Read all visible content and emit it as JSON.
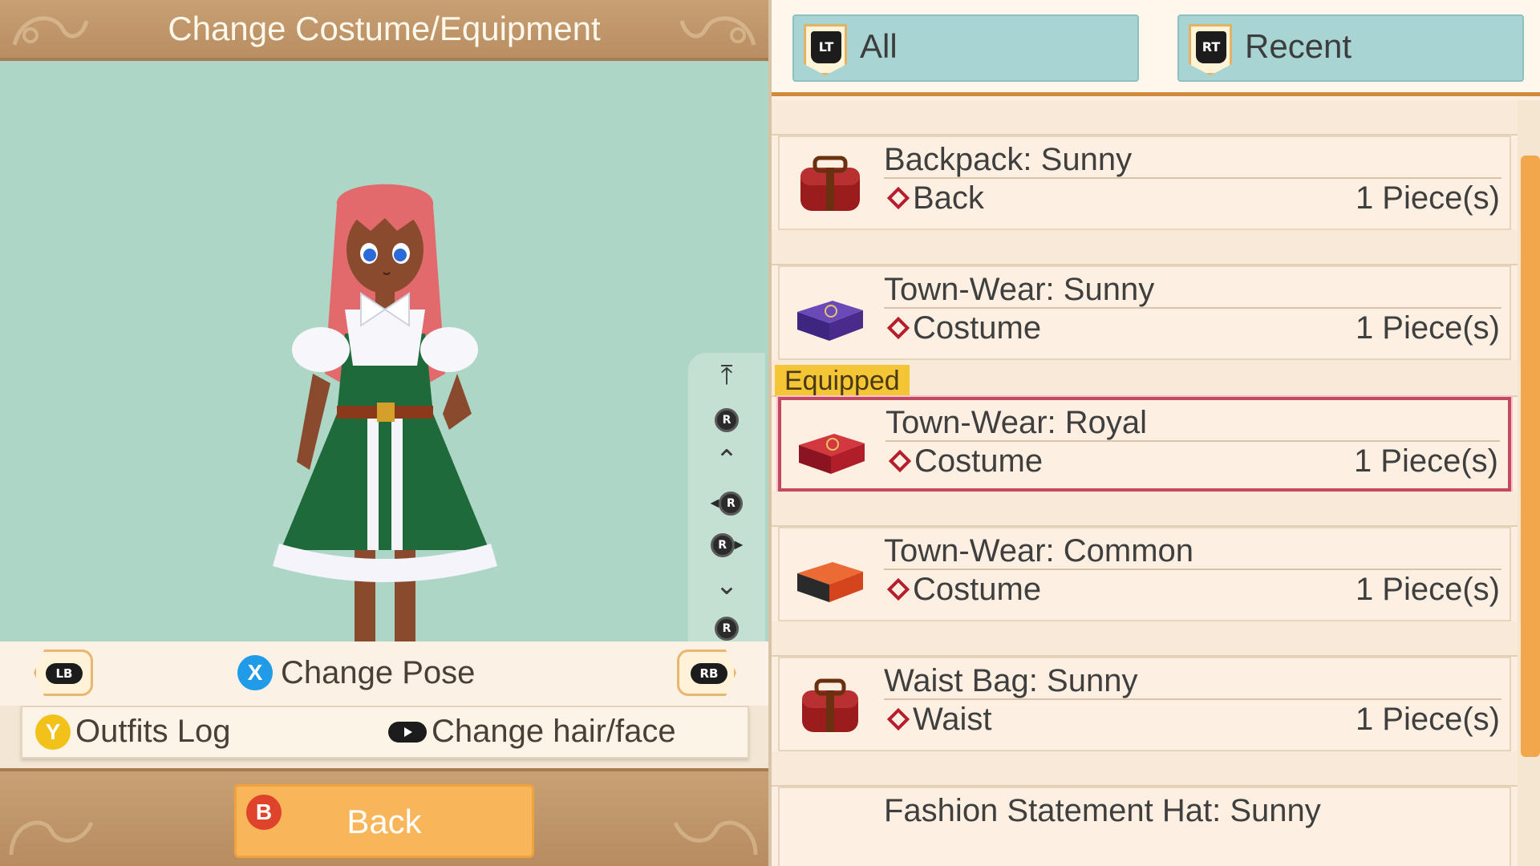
{
  "header": {
    "title": "Change Costume/Equipment"
  },
  "controls": {
    "lb": "LB",
    "rb": "RB",
    "x_glyph": "X",
    "change_pose": "Change Pose",
    "y_glyph": "Y",
    "outfits_log": "Outfits Log",
    "change_hair_face": "Change hair/face",
    "b_glyph": "B",
    "back": "Back",
    "r_glyph": "R"
  },
  "tabs": [
    {
      "trigger": "LT",
      "label": "All"
    },
    {
      "trigger": "RT",
      "label": "Recent"
    }
  ],
  "equipped_badge": "Equipped",
  "items": [
    {
      "name": "Backpack: Sunny",
      "slot": "Back",
      "qty": "1 Piece(s)",
      "icon": "red-backpack-icon",
      "color": "#9b1c1c",
      "equipped": false
    },
    {
      "name": "Town-Wear: Sunny",
      "slot": "Costume",
      "qty": "1 Piece(s)",
      "icon": "purple-case-icon",
      "color": "#4a2a8a",
      "equipped": false
    },
    {
      "name": "Town-Wear: Royal",
      "slot": "Costume",
      "qty": "1 Piece(s)",
      "icon": "red-case-icon",
      "color": "#b01e2a",
      "equipped": true
    },
    {
      "name": "Town-Wear: Common",
      "slot": "Costume",
      "qty": "1 Piece(s)",
      "icon": "orange-case-icon",
      "color": "#d4451e",
      "equipped": false
    },
    {
      "name": "Waist Bag: Sunny",
      "slot": "Waist",
      "qty": "1 Piece(s)",
      "icon": "red-waist-bag-icon",
      "color": "#9b1c1c",
      "equipped": false
    },
    {
      "name": "Fashion Statement Hat: Sunny",
      "slot": "",
      "qty": "",
      "icon": "hat-icon",
      "color": "#9b1c1c",
      "equipped": false
    }
  ],
  "colors": {
    "viewport_bg": "#add6c6",
    "accent_orange": "#f2a84a",
    "tab_bg": "#a8d4d3",
    "equipped_border": "#c34860",
    "equipped_badge": "#f4c534"
  }
}
